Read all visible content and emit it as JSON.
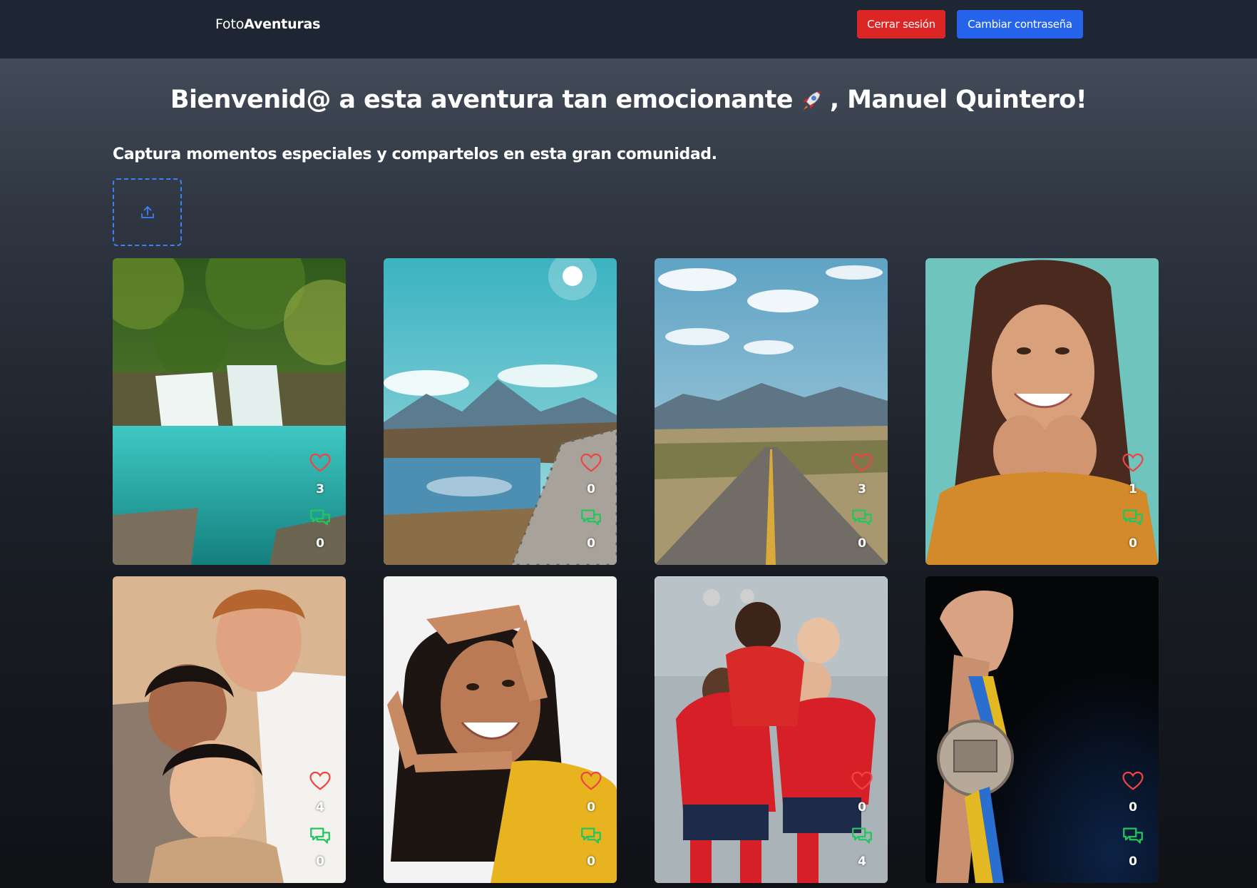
{
  "header": {
    "brand_prefix": "Foto",
    "brand_bold": "Aventuras",
    "logout_label": "Cerrar sesión",
    "change_password_label": "Cambiar contraseña"
  },
  "main": {
    "welcome_before": "Bienvenid@ a esta aventura tan emocionante",
    "welcome_after": ", Manuel Quintero!",
    "subtitle": "Captura momentos especiales y compartelos en esta gran comunidad.",
    "upload_icon": "upload-icon"
  },
  "colors": {
    "accent_blue": "#2563eb",
    "danger_red": "#dc2626",
    "like_icon": "#ef4444",
    "comment_icon": "#22c55e"
  },
  "photos": [
    {
      "subject": "waterfall",
      "likes": "3",
      "comments": "0"
    },
    {
      "subject": "mountain-lake-boardwalk",
      "likes": "0",
      "comments": "0"
    },
    {
      "subject": "desert-road-mountains",
      "likes": "3",
      "comments": "0"
    },
    {
      "subject": "smiling-woman-teal",
      "likes": "1",
      "comments": "0"
    },
    {
      "subject": "three-friends",
      "likes": "4",
      "comments": "0"
    },
    {
      "subject": "woman-finger-frame",
      "likes": "0",
      "comments": "0"
    },
    {
      "subject": "soccer-team-celebration",
      "likes": "0",
      "comments": "4"
    },
    {
      "subject": "hand-holding-medal",
      "likes": "0",
      "comments": "0"
    }
  ]
}
